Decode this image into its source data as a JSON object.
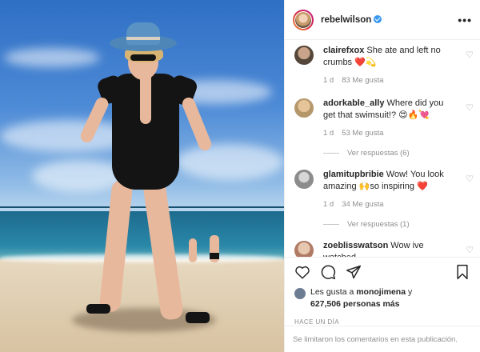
{
  "post": {
    "author": "rebelwilson",
    "more_icon": "•••",
    "icons": [
      "heart-icon",
      "comment-icon",
      "share-icon",
      "bookmark-icon"
    ]
  },
  "comments": [
    {
      "user": "clairefxox",
      "text": "She ate and left no crumbs ❤️💫",
      "age": "1 d",
      "likes": "83 Me gusta",
      "replies": ""
    },
    {
      "user": "adorkable_ally",
      "text": "Where did you get that swimsuit!? 😍🔥💘",
      "age": "1 d",
      "likes": "53 Me gusta",
      "replies": "Ver respuestas (6)"
    },
    {
      "user": "glamitupbribie",
      "text": "Wow! You look amazing 🙌so inspiring ❤️",
      "age": "1 d",
      "likes": "34 Me gusta",
      "replies": "Ver respuestas (1)"
    },
    {
      "user": "zoeblisswatson",
      "text": "Wow ive watched",
      "age": "",
      "likes": "",
      "replies": ""
    }
  ],
  "likes": {
    "prefix": "Les gusta a ",
    "first_user": "monojimena",
    "middle": " y",
    "count": "627,506 personas más"
  },
  "timestamp": "HACE UN DÍA",
  "footer": "Se limitaron los comentarios en esta publicación."
}
